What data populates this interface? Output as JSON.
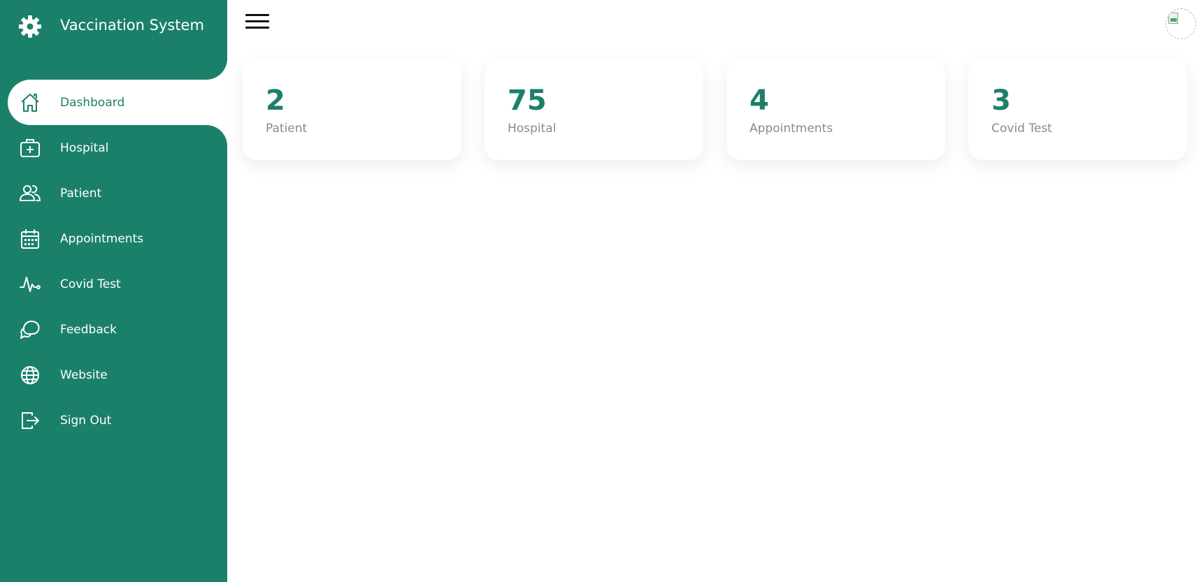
{
  "brand": {
    "title": "Vaccination System",
    "icon": "gear-icon"
  },
  "colors": {
    "accent": "#1b806a",
    "text_muted": "#8a8a8a",
    "background": "#ffffff"
  },
  "sidebar": {
    "items": [
      {
        "label": "Dashboard",
        "icon": "home-icon",
        "active": true
      },
      {
        "label": "Hospital",
        "icon": "medical-kit-icon",
        "active": false
      },
      {
        "label": "Patient",
        "icon": "people-icon",
        "active": false
      },
      {
        "label": "Appointments",
        "icon": "calendar-icon",
        "active": false
      },
      {
        "label": "Covid Test",
        "icon": "pulse-icon",
        "active": false
      },
      {
        "label": "Feedback",
        "icon": "chat-bubbles-icon",
        "active": false
      },
      {
        "label": "Website",
        "icon": "globe-icon",
        "active": false
      },
      {
        "label": "Sign Out",
        "icon": "logout-icon",
        "active": false
      }
    ]
  },
  "topbar": {
    "menu_icon": "hamburger-menu-icon",
    "avatar": "user-avatar"
  },
  "cards": [
    {
      "number": "2",
      "label": "Patient"
    },
    {
      "number": "75",
      "label": "Hospital"
    },
    {
      "number": "4",
      "label": "Appointments"
    },
    {
      "number": "3",
      "label": "Covid Test"
    }
  ]
}
